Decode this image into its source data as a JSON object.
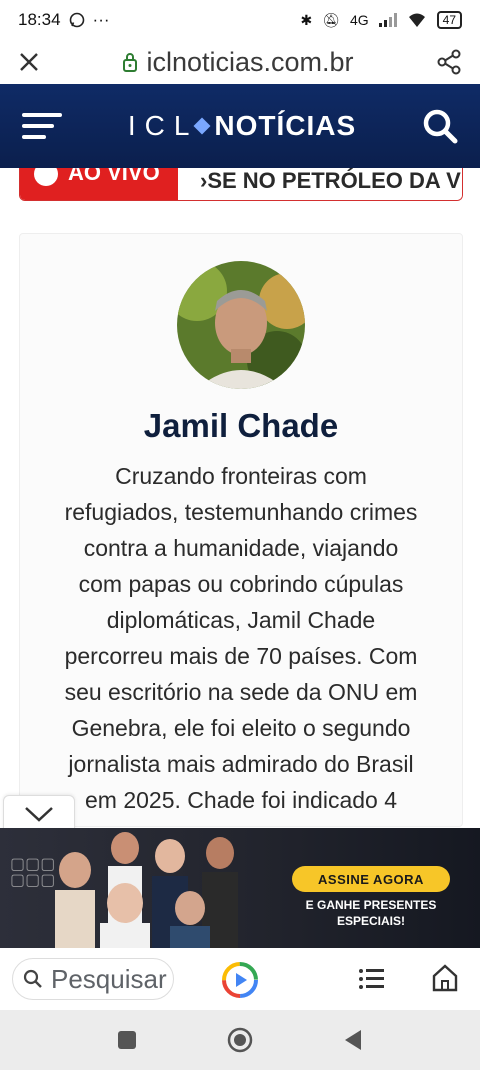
{
  "status_bar": {
    "time": "18:34",
    "battery": "47",
    "network": "4G"
  },
  "url_bar": {
    "domain": "iclnoticias.com.br"
  },
  "header": {
    "logo_left": "ICL",
    "logo_right": "NOTÍCIAS"
  },
  "ticker": {
    "live_label": "AO VIVO",
    "headline": "›SE NO PETRÓLEO DA V"
  },
  "author": {
    "name": "Jamil Chade",
    "bio": "Cruzando fronteiras com refugiados, testemunhando crimes contra a humanidade, viajando com papas ou cobrindo cúpulas diplomáticas, Jamil Chade percorreu mais de 70 países. Com seu escritório na sede da ONU em Genebra, ele foi eleito o segundo jornalista mais admirado do Brasil em 2025. Chade foi indicado 4"
  },
  "ad": {
    "cta": "ASSINE AGORA",
    "sub": "E GANHE PRESENTES ESPECIAIS!"
  },
  "toolbar": {
    "search_placeholder": "Pesquisar"
  },
  "colors": {
    "header_bg": "#0b1f4d",
    "live_red": "#e02020",
    "cta_yellow": "#f7c628",
    "name_color": "#0f1f3d"
  }
}
